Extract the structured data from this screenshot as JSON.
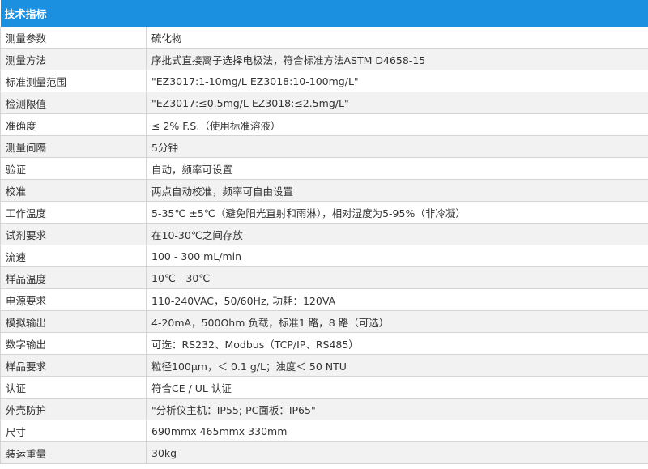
{
  "header": {
    "title": "技术指标"
  },
  "rows": [
    {
      "label": "测量参数",
      "value": "硫化物"
    },
    {
      "label": "测量方法",
      "value": "序批式直接离子选择电极法，符合标准方法ASTM D4658-15"
    },
    {
      "label": "标准测量范围",
      "value": "\"EZ3017:1-10mg/L      EZ3018:10-100mg/L\""
    },
    {
      "label": "检测限值",
      "value": "\"EZ3017:≤0.5mg/L      EZ3018:≤2.5mg/L\""
    },
    {
      "label": "准确度",
      "value": "≤ 2% F.S.（使用标准溶液）"
    },
    {
      "label": "测量间隔",
      "value": "5分钟"
    },
    {
      "label": "验证",
      "value": "自动，频率可设置"
    },
    {
      "label": "校准",
      "value": "两点自动校准，频率可自由设置"
    },
    {
      "label": "工作温度",
      "value": "5-35℃ ±5℃（避免阳光直射和雨淋），相对湿度为5-95%（非冷凝）"
    },
    {
      "label": "试剂要求",
      "value": "在10-30℃之间存放"
    },
    {
      "label": "流速",
      "value": "100 - 300 mL/min"
    },
    {
      "label": "样品温度",
      "value": "10℃ - 30℃"
    },
    {
      "label": "电源要求",
      "value": "110-240VAC，50/60Hz, 功耗：120VA"
    },
    {
      "label": "模拟输出",
      "value": "4-20mA，500Ohm 负载，标准1 路，8 路（可选）"
    },
    {
      "label": "数字输出",
      "value": "可选：RS232、Modbus（TCP/IP、RS485）"
    },
    {
      "label": "样品要求",
      "value": "粒径100μm，＜ 0.1 g/L；浊度＜ 50 NTU"
    },
    {
      "label": "认证",
      "value": "符合CE / UL 认证"
    },
    {
      "label": "外壳防护",
      "value": "\"分析仪主机：IP55;     PC面板：IP65\""
    },
    {
      "label": "尺寸",
      "value": "690mmx 465mmx 330mm"
    },
    {
      "label": "装运重量",
      "value": "30kg"
    }
  ]
}
